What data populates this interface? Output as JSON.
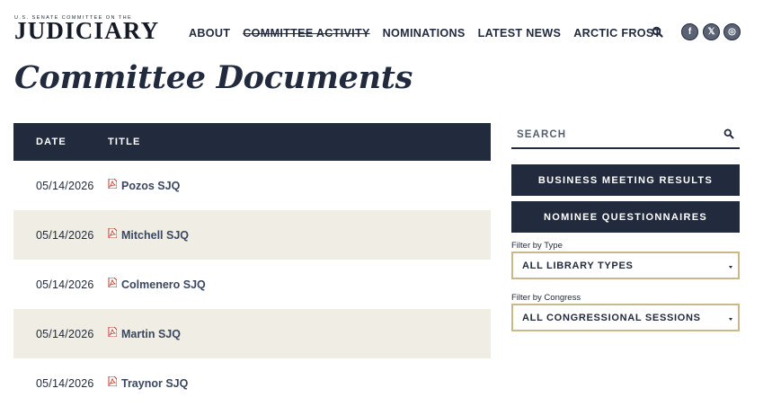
{
  "header": {
    "logo_sub": "U.S. SENATE COMMITTEE ON THE",
    "logo_main": "JUDICIARY",
    "nav": [
      {
        "label": "ABOUT"
      },
      {
        "label": "COMMITTEE ACTIVITY"
      },
      {
        "label": "NOMINATIONS"
      },
      {
        "label": "LATEST NEWS"
      },
      {
        "label": "ARCTIC FROST"
      }
    ],
    "social": {
      "facebook": "f",
      "x": "𝕏",
      "instagram": "◎"
    }
  },
  "page": {
    "title": "Committee Documents"
  },
  "table": {
    "headers": {
      "date": "DATE",
      "title": "TITLE"
    },
    "rows": [
      {
        "date": "05/14/2026",
        "title": "Pozos SJQ"
      },
      {
        "date": "05/14/2026",
        "title": "Mitchell SJQ"
      },
      {
        "date": "05/14/2026",
        "title": "Colmenero SJQ"
      },
      {
        "date": "05/14/2026",
        "title": "Martin SJQ"
      },
      {
        "date": "05/14/2026",
        "title": "Traynor SJQ"
      }
    ]
  },
  "sidebar": {
    "search_placeholder": "SEARCH",
    "buttons": [
      "BUSINESS MEETING RESULTS",
      "NOMINEE QUESTIONNAIRES"
    ],
    "filters": [
      {
        "label": "Filter by Type",
        "value": "ALL LIBRARY TYPES"
      },
      {
        "label": "Filter by Congress",
        "value": "ALL CONGRESSIONAL SESSIONS"
      }
    ]
  },
  "colors": {
    "navy": "#222b3e",
    "row_alt": "#efede4",
    "select_border": "#c9b98a",
    "pdf_red": "#c0392b"
  }
}
